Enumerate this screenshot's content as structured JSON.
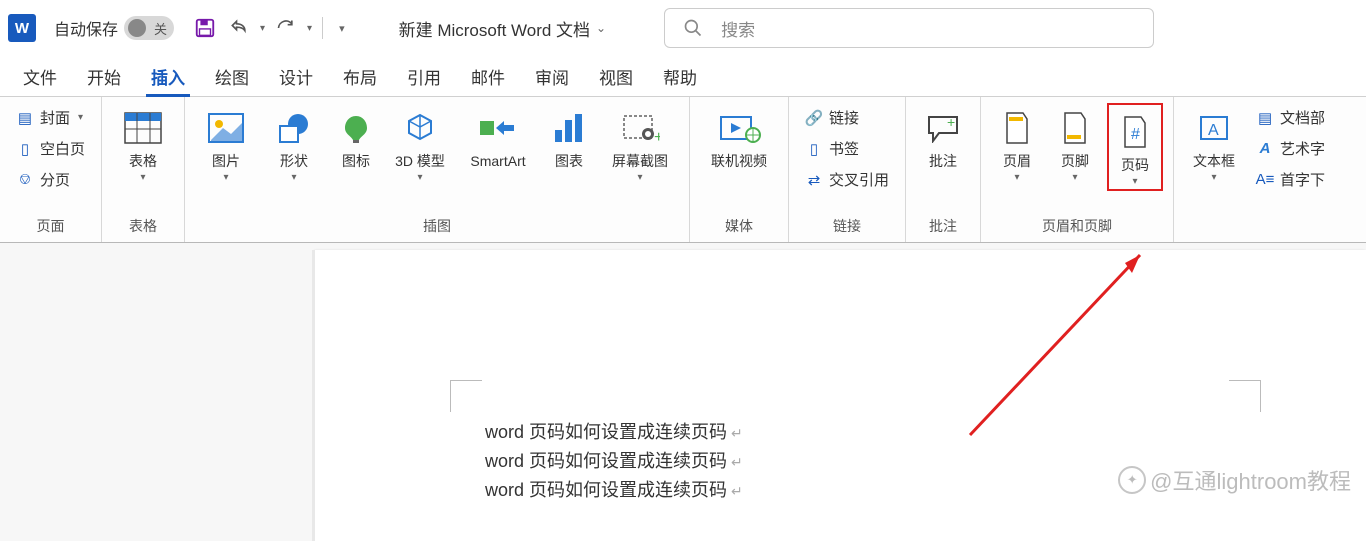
{
  "titlebar": {
    "autosave_label": "自动保存",
    "switch_state": "关",
    "doc_title": "新建 Microsoft Word 文档",
    "search_placeholder": "搜索"
  },
  "tabs": [
    "文件",
    "开始",
    "插入",
    "绘图",
    "设计",
    "布局",
    "引用",
    "邮件",
    "审阅",
    "视图",
    "帮助"
  ],
  "active_tab_index": 2,
  "ribbon": {
    "g_pages": {
      "label": "页面",
      "cover": "封面",
      "blank": "空白页",
      "break": "分页"
    },
    "g_tables": {
      "label": "表格",
      "table": "表格"
    },
    "g_illus": {
      "label": "插图",
      "pic": "图片",
      "shapes": "形状",
      "icons": "图标",
      "model3d": "3D 模型",
      "smartart": "SmartArt",
      "chart": "图表",
      "screenshot": "屏幕截图"
    },
    "g_media": {
      "label": "媒体",
      "video": "联机视频"
    },
    "g_links": {
      "label": "链接",
      "link": "链接",
      "bookmark": "书签",
      "crossref": "交叉引用"
    },
    "g_comments": {
      "label": "批注",
      "comment": "批注"
    },
    "g_hf": {
      "label": "页眉和页脚",
      "header": "页眉",
      "footer": "页脚",
      "pagenum": "页码"
    },
    "g_text": {
      "label": "",
      "textbox": "文本框",
      "quickparts": "文档部",
      "wordart": "艺术字",
      "dropcap": "首字下"
    }
  },
  "document_lines": [
    "word 页码如何设置成连续页码",
    "word 页码如何设置成连续页码",
    "word 页码如何设置成连续页码"
  ],
  "watermark": "@互通lightroom教程"
}
